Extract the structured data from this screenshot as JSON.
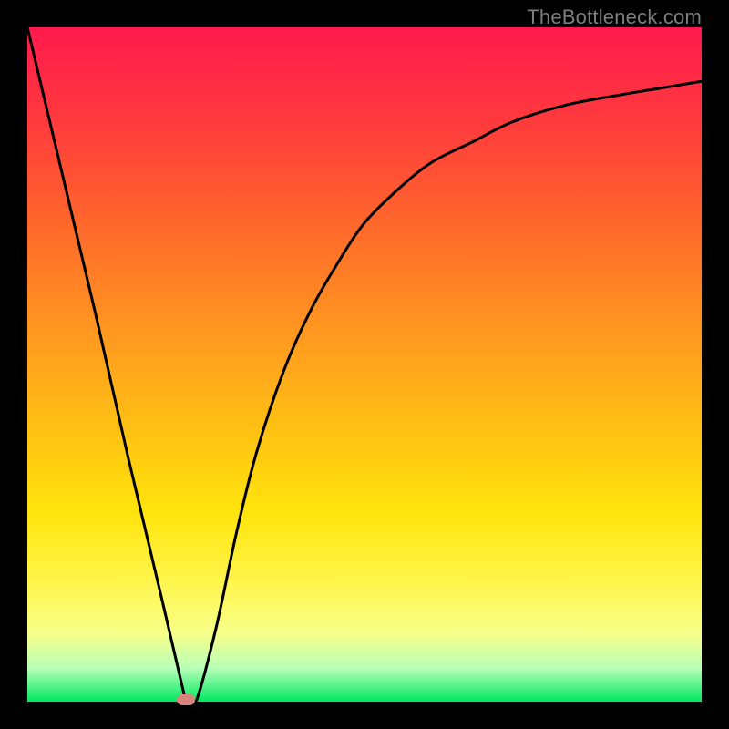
{
  "watermark": "TheBottleneck.com",
  "chart_data": {
    "type": "line",
    "title": "",
    "xlabel": "",
    "ylabel": "",
    "xlim": [
      0,
      1
    ],
    "ylim": [
      0,
      1
    ],
    "series": [
      {
        "name": "curve",
        "x": [
          0.0,
          0.05,
          0.1,
          0.15,
          0.2,
          0.235,
          0.25,
          0.28,
          0.31,
          0.34,
          0.38,
          0.42,
          0.46,
          0.5,
          0.55,
          0.6,
          0.66,
          0.72,
          0.8,
          0.88,
          0.94,
          1.0
        ],
        "y": [
          1.0,
          0.79,
          0.58,
          0.36,
          0.15,
          0.0,
          0.0,
          0.11,
          0.25,
          0.37,
          0.49,
          0.58,
          0.65,
          0.71,
          0.76,
          0.8,
          0.83,
          0.86,
          0.885,
          0.9,
          0.91,
          0.92
        ]
      }
    ],
    "annotations": [
      {
        "type": "marker",
        "x": 0.235,
        "y": 0.0,
        "color": "#d9837d"
      }
    ],
    "background": {
      "type": "vertical-gradient",
      "stops": [
        {
          "pos": 0.0,
          "color": "#ff1a4d"
        },
        {
          "pos": 0.46,
          "color": "#ff9a1f"
        },
        {
          "pos": 0.82,
          "color": "#fff54a"
        },
        {
          "pos": 1.0,
          "color": "#00e860"
        }
      ]
    }
  }
}
